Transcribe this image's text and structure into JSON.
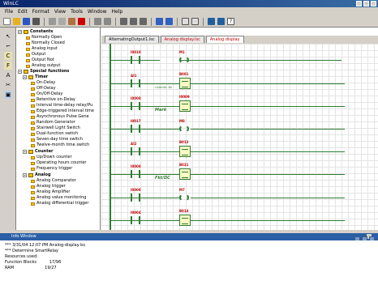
{
  "window": {
    "title": "WinLC"
  },
  "menu": [
    "File",
    "Edit",
    "Format",
    "View",
    "Tools",
    "Window",
    "Help"
  ],
  "tabs": [
    {
      "label": "AlternatingOutput1.lsc",
      "active": false,
      "red": false
    },
    {
      "label": "Analog display.lsc",
      "active": false,
      "red": true
    },
    {
      "label": "Analog display",
      "active": true,
      "red": true
    }
  ],
  "tree": {
    "constants": {
      "label": "Constants",
      "items": [
        "Normally Open",
        "Normally Closed",
        "Analog input",
        "Output",
        "Output Not",
        "Analog output"
      ]
    },
    "special_functions": {
      "label": "Special functions"
    },
    "timer": {
      "label": "Timer",
      "items": [
        "On-Delay",
        "Off-Delay",
        "On/Off-Delay",
        "Retentive on-Delay",
        "Interval time-delay relay/Pu",
        "Edge-triggered interval time",
        "Asynchronous Pulse Gene",
        "Random Generator",
        "Stairwell Light Switch",
        "Dual-function switch",
        "Seven-day time switch",
        "Twelve-month time switch"
      ]
    },
    "counter": {
      "label": "Counter",
      "items": [
        "Up/Down counter",
        "Operating hours counter",
        "Frequency trigger"
      ]
    },
    "analog": {
      "label": "Analog",
      "items": [
        "Analog Comparator",
        "Analog trigger",
        "Analog Amplifier",
        "Analog value monitoring",
        "Analog differential trigger"
      ]
    }
  },
  "diagram": {
    "contacts": [
      "I0010",
      "AI1",
      "I0008",
      "I0017",
      "AI2",
      "I0008",
      "I0008",
      "I0004"
    ],
    "coils": [
      "M1",
      "B001",
      "I0009",
      "M8",
      "B013",
      "B021",
      "M7",
      "B014"
    ],
    "notes": [
      "ListenNr. BS",
      "Mark",
      "Fkt/DC"
    ]
  },
  "info": {
    "title": "Info Window",
    "lines": [
      "*** 3/31/04 12:07 PM Analog-display.lsc",
      "*** Determine SmartRelay",
      "Resources used:",
      "Function Blocks          17/96",
      "RAM                        19/27"
    ]
  },
  "colors": {
    "rung": "#2e7d32",
    "title": "#0a246a",
    "info_header": "#2b5fa6"
  }
}
